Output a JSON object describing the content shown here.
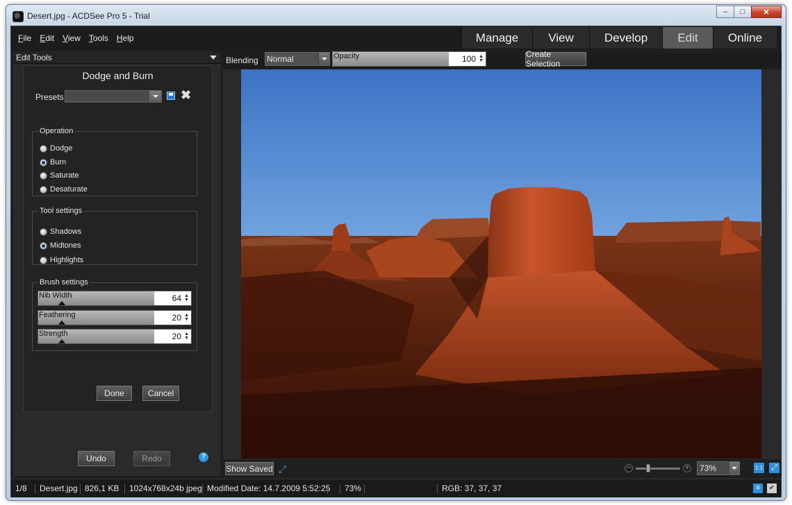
{
  "window": {
    "title": "Desert.jpg - ACDSee Pro 5 - Trial"
  },
  "menu": [
    "File",
    "Edit",
    "View",
    "Tools",
    "Help"
  ],
  "modes": [
    {
      "label": "Manage",
      "active": false
    },
    {
      "label": "View",
      "active": false
    },
    {
      "label": "Develop",
      "active": false
    },
    {
      "label": "Edit",
      "active": true
    },
    {
      "label": "Online",
      "active": false
    }
  ],
  "panel": {
    "header": "Edit Tools",
    "tool_title": "Dodge and Burn",
    "presets_label": "Presets",
    "presets_value": "",
    "operation": {
      "legend": "Operation",
      "options": [
        {
          "label": "Dodge",
          "checked": false
        },
        {
          "label": "Burn",
          "checked": true
        },
        {
          "label": "Saturate",
          "checked": false
        },
        {
          "label": "Desaturate",
          "checked": false
        }
      ]
    },
    "tool_settings": {
      "legend": "Tool settings",
      "options": [
        {
          "label": "Shadows",
          "checked": false
        },
        {
          "label": "Midtones",
          "checked": true
        },
        {
          "label": "Highlights",
          "checked": false
        }
      ]
    },
    "brush_settings": {
      "legend": "Brush settings",
      "sliders": [
        {
          "label": "Nib Width",
          "value": "64",
          "level": 0.2
        },
        {
          "label": "Feathering",
          "value": "20",
          "level": 0.2
        },
        {
          "label": "Strength",
          "value": "20",
          "level": 0.2
        }
      ]
    },
    "done_label": "Done",
    "cancel_label": "Cancel",
    "undo_label": "Undo",
    "redo_label": "Redo",
    "help_icon": "help-icon"
  },
  "edit_toolbar": {
    "blending_label": "Blending",
    "blending_value": "Normal",
    "opacity_label": "Opacity",
    "opacity_value": "100",
    "create_selection": "Create Selection"
  },
  "canvas_bottom": {
    "show_saved": "Show Saved",
    "zoom_value": "73%",
    "actual_size": "1:1"
  },
  "status": {
    "index": "1/8",
    "filename": "Desert.jpg",
    "filesize": "826,1 KB",
    "dimensions": "1024x768x24b jpeg",
    "modified": "Modified Date: 14.7.2009 5:52:25",
    "zoom": "73%",
    "rgb": "RGB: 37, 37, 37"
  },
  "colors": {
    "active_tab": "#5a5a5a",
    "accent_blue": "#2f8fdd"
  }
}
